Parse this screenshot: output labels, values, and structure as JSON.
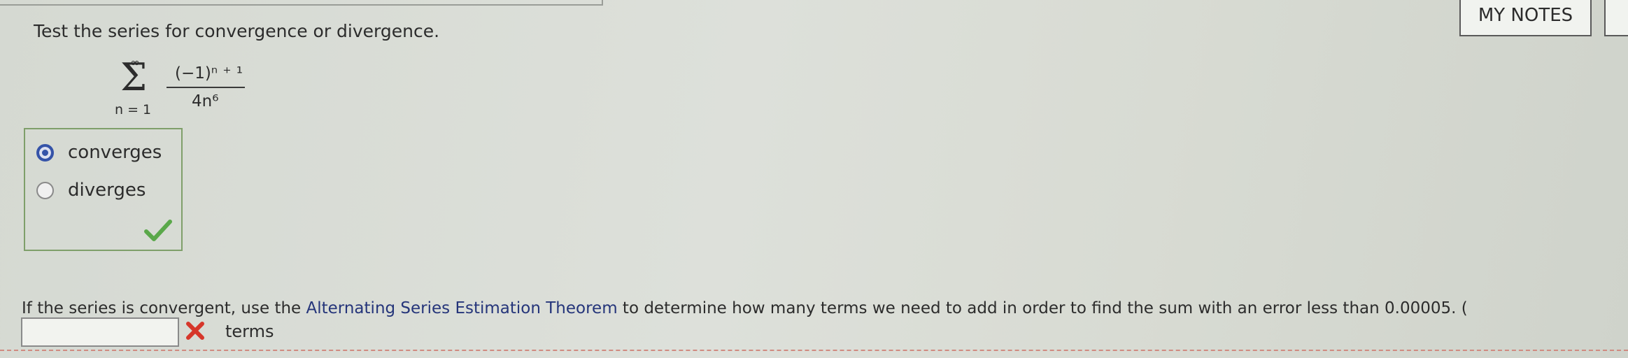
{
  "question": {
    "prompt": "Test the series for convergence or divergence."
  },
  "series": {
    "upper_limit": "∞",
    "sigma": "Σ",
    "lower_limit": "n = 1",
    "numerator": "(−1)ⁿ ⁺ ¹",
    "denominator": "4n⁶"
  },
  "choices": {
    "options": [
      {
        "label": "converges",
        "selected": true
      },
      {
        "label": "diverges",
        "selected": false
      }
    ],
    "status_icon": "checkmark-icon",
    "status_color": "#5aa84a"
  },
  "header": {
    "notes_label": "MY NOTES"
  },
  "followup": {
    "prefix": "If the series is convergent, use the ",
    "link": "Alternating Series Estimation Theorem",
    "suffix": " to determine how many terms we need to add in order to find the sum with an error less than 0.00005. (",
    "answer_value": "",
    "status_icon": "x-icon",
    "status_color": "#d6362a",
    "unit": "terms"
  }
}
